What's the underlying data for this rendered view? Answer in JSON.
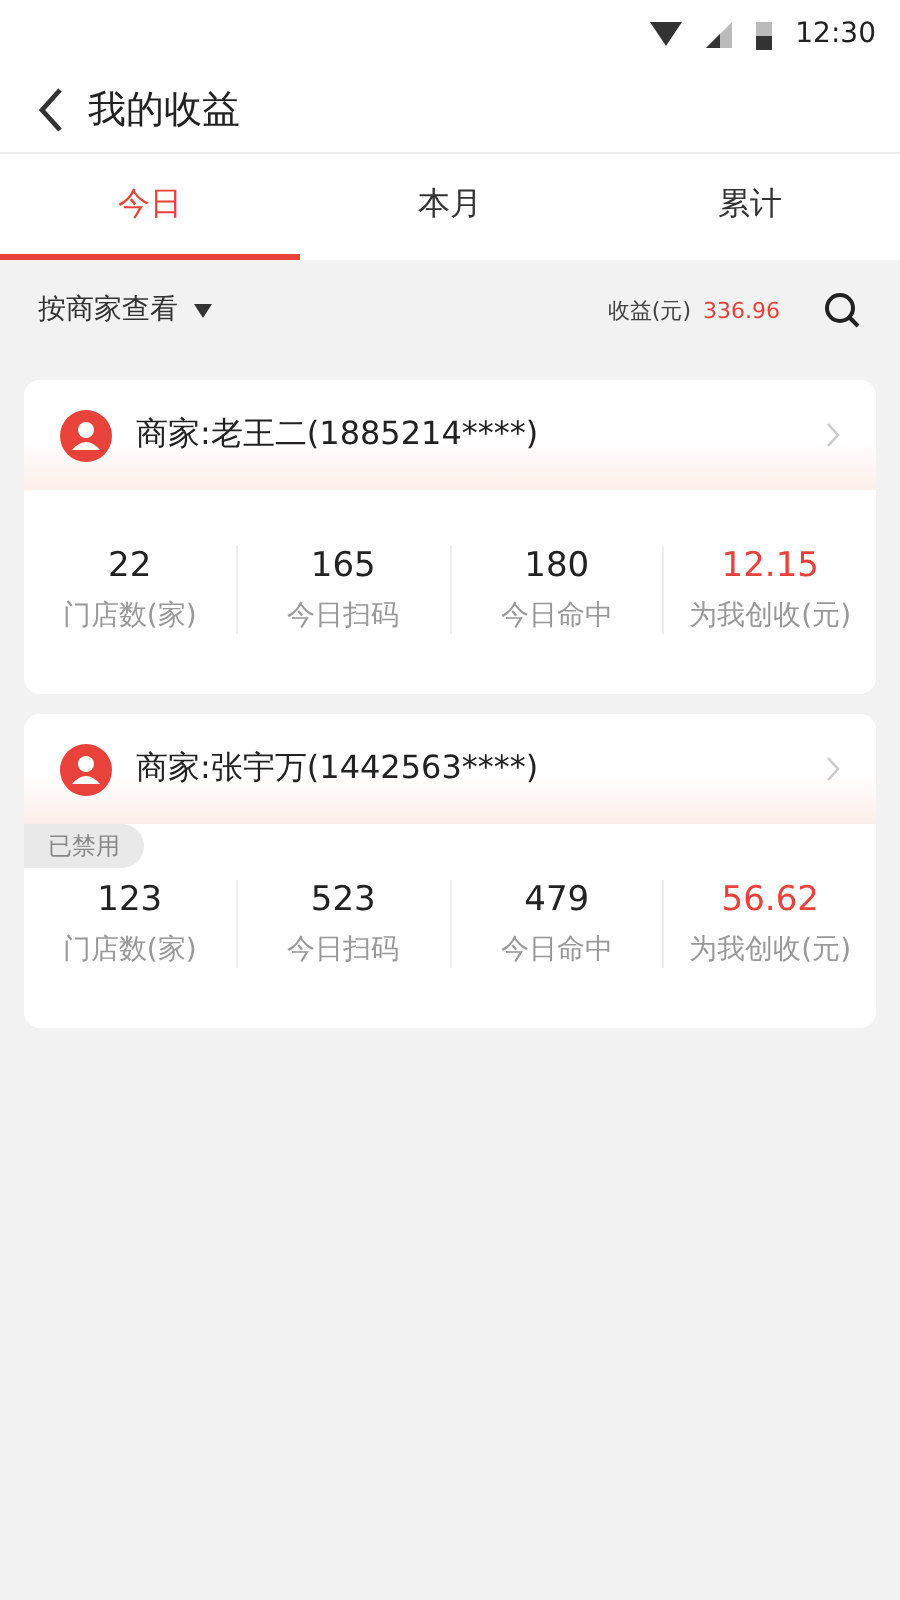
{
  "status_bar": {
    "time": "12:30"
  },
  "header": {
    "title": "我的收益"
  },
  "tabs": [
    {
      "label": "今日",
      "selected": true
    },
    {
      "label": "本月",
      "selected": false
    },
    {
      "label": "累计",
      "selected": false
    }
  ],
  "filter": {
    "label": "按商家查看",
    "earnings_label": "收益(元)",
    "earnings_value": "336.96"
  },
  "merchants": [
    {
      "name": "商家:老王二(1885214****)",
      "disabled": false,
      "stats": [
        {
          "value": "22",
          "label": "门店数(家)",
          "highlight": false
        },
        {
          "value": "165",
          "label": "今日扫码",
          "highlight": false
        },
        {
          "value": "180",
          "label": "今日命中",
          "highlight": false
        },
        {
          "value": "12.15",
          "label": "为我创收(元)",
          "highlight": true
        }
      ]
    },
    {
      "name": "商家:张宇万(1442563****)",
      "disabled": true,
      "disabled_label": "已禁用",
      "stats": [
        {
          "value": "123",
          "label": "门店数(家)",
          "highlight": false
        },
        {
          "value": "523",
          "label": "今日扫码",
          "highlight": false
        },
        {
          "value": "479",
          "label": "今日命中",
          "highlight": false
        },
        {
          "value": "56.62",
          "label": "为我创收(元)",
          "highlight": true
        }
      ]
    }
  ]
}
